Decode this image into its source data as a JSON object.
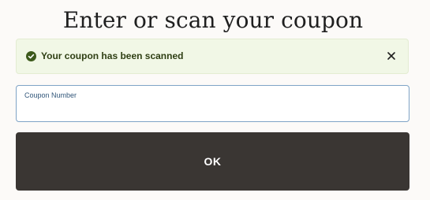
{
  "page": {
    "title": "Enter or scan your coupon"
  },
  "alert": {
    "message": "Your coupon has been scanned",
    "status_icon": "check-circle-icon",
    "close_icon": "close-icon",
    "color": "#3d5a1c"
  },
  "coupon_field": {
    "label": "Coupon Number",
    "value": ""
  },
  "actions": {
    "ok_label": "OK",
    "ok_color": "#3a3633"
  }
}
